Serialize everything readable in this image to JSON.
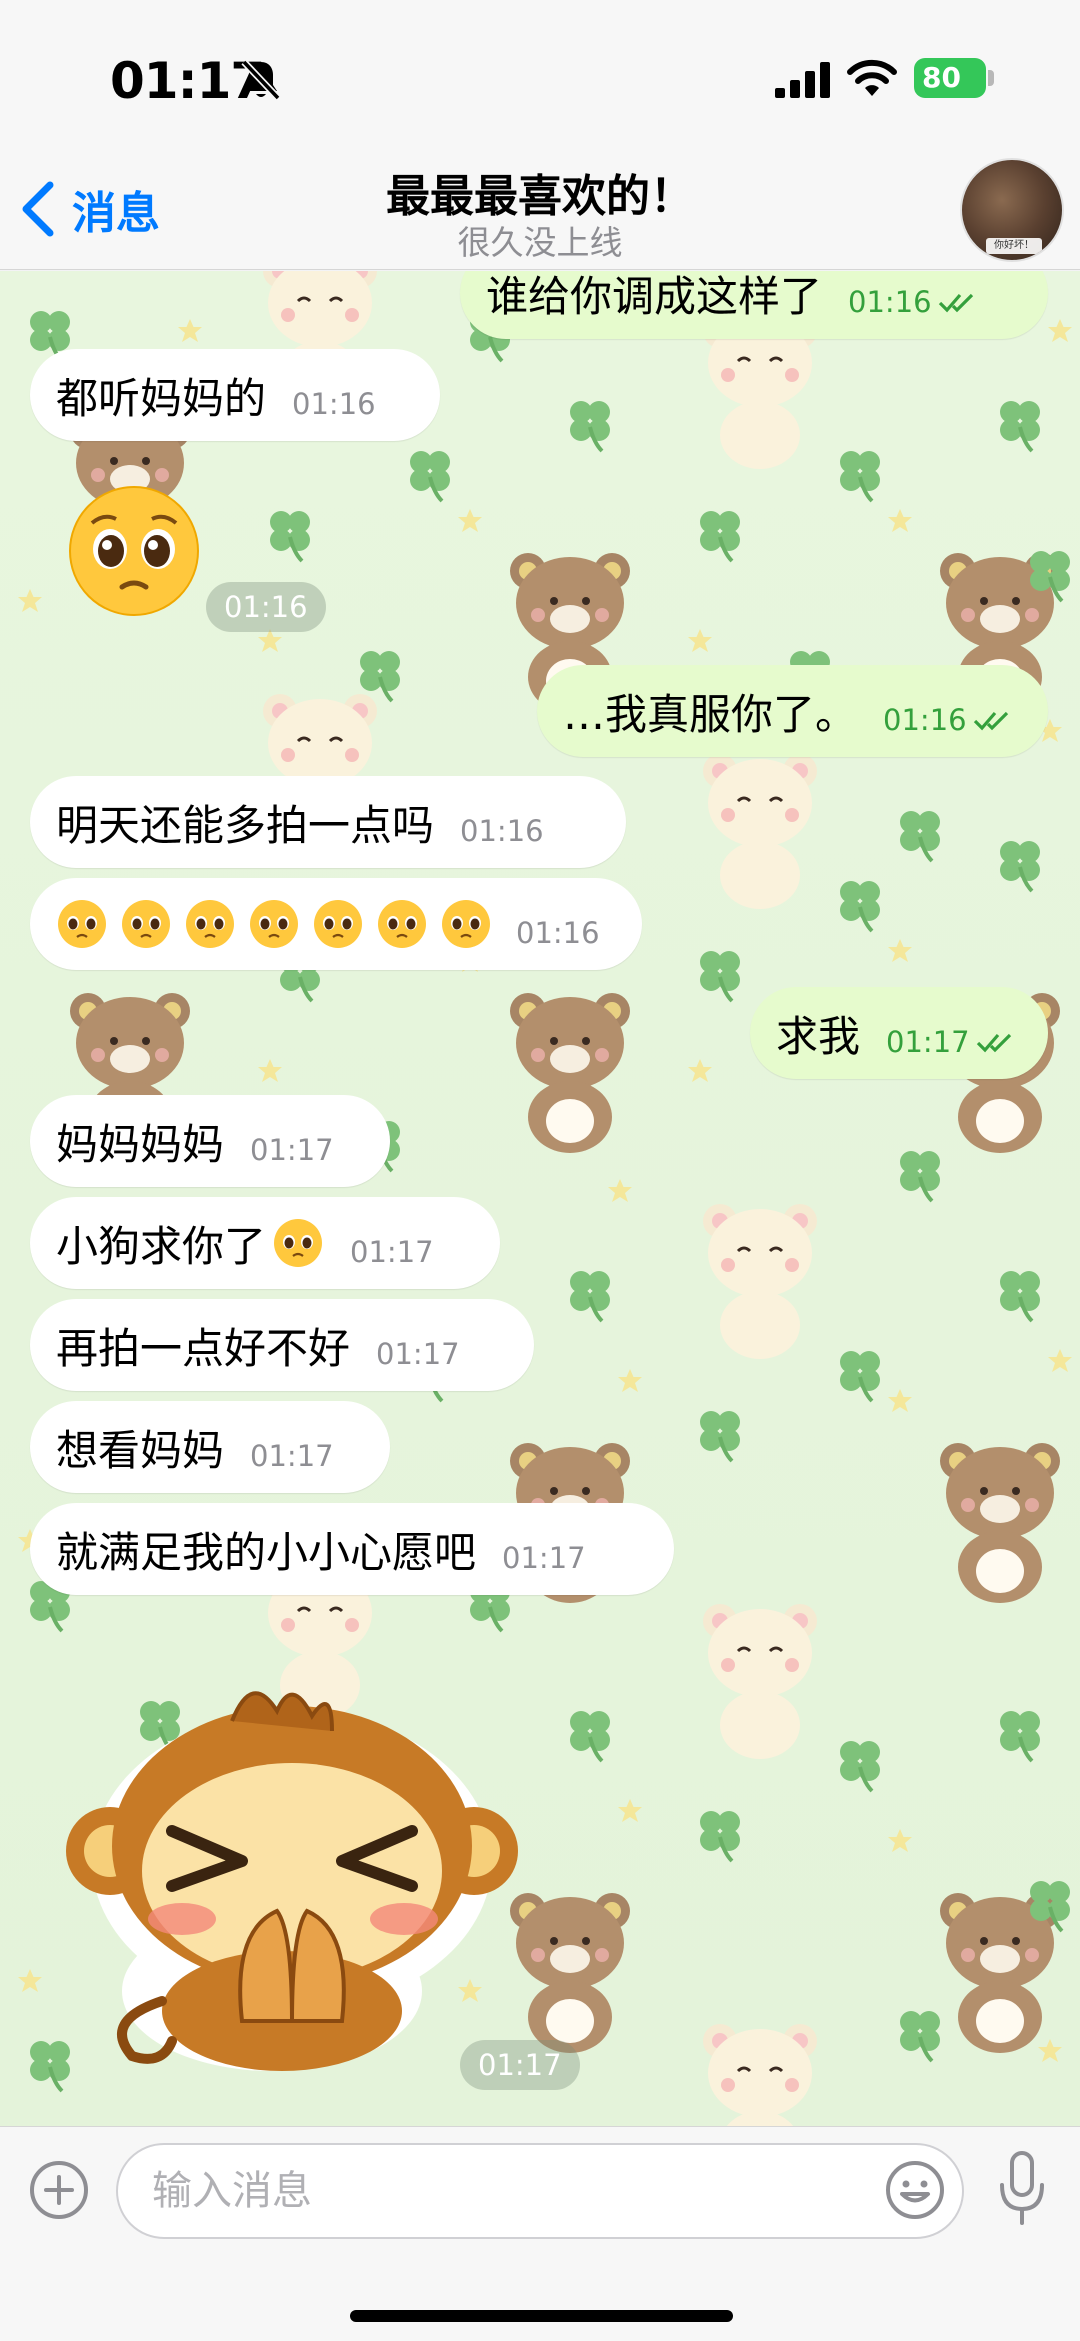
{
  "status_bar": {
    "time": "01:17",
    "battery": "80",
    "icons": [
      "bell-slash-icon",
      "signal-icon",
      "wifi-icon",
      "battery-icon"
    ]
  },
  "header": {
    "back_label": "消息",
    "title": "最最最喜欢的！",
    "subtitle": "很久没上线",
    "avatar_caption": "你好坏！"
  },
  "messages": [
    {
      "dir": "out",
      "text": "谁给你调成这样了",
      "time": "01:16",
      "read": true
    },
    {
      "dir": "in",
      "text": "都听妈妈的",
      "time": "01:16"
    },
    {
      "dir": "in",
      "sticker": "pleading-face-emoji",
      "time": "01:16"
    },
    {
      "dir": "out",
      "text": "…我真服你了。",
      "time": "01:16",
      "read": true
    },
    {
      "dir": "in",
      "text": "明天还能多拍一点吗",
      "time": "01:16"
    },
    {
      "dir": "in",
      "emoji_row": "pleading-face-emoji",
      "emoji_count": 7,
      "time": "01:16"
    },
    {
      "dir": "out",
      "text": "求我",
      "time": "01:17",
      "read": true
    },
    {
      "dir": "in",
      "text": "妈妈妈妈",
      "time": "01:17"
    },
    {
      "dir": "in",
      "text": "小狗求你了",
      "trailing_emoji": "pleading-face-emoji",
      "time": "01:17"
    },
    {
      "dir": "in",
      "text": "再拍一点好不好",
      "time": "01:17"
    },
    {
      "dir": "in",
      "text": "想看妈妈",
      "time": "01:17"
    },
    {
      "dir": "in",
      "text": "就满足我的小小心愿吧",
      "time": "01:17"
    },
    {
      "dir": "in",
      "sticker": "begging-monkey-sticker",
      "time": "01:17"
    }
  ],
  "input": {
    "placeholder": "输入消息"
  },
  "colors": {
    "accent": "#007aff",
    "out_bubble": "#e6fbcd",
    "in_bubble": "#ffffff",
    "read_ticks": "#34a03c",
    "wallpaper": "#dff2d4"
  }
}
